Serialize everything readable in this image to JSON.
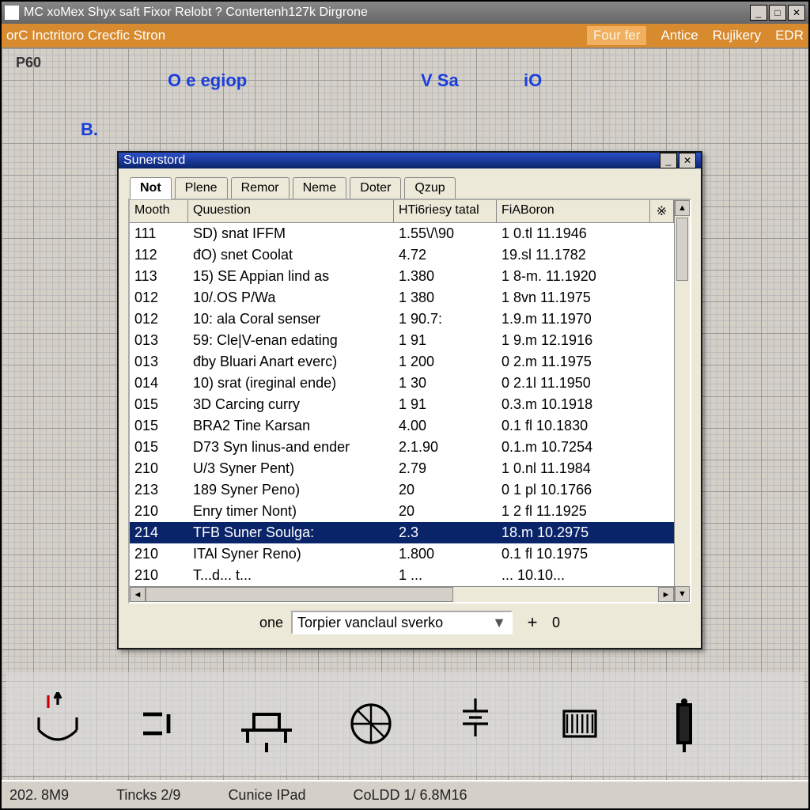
{
  "main_window": {
    "title": "MC xoMex Shyx saft Fixor Relobt ? Contertenh127k Dirgrone"
  },
  "menubar": {
    "left_label": "orC Inctritoro Crecfic Stron",
    "items": [
      "Four fer",
      "Antice",
      "Rujikery",
      "EDR"
    ]
  },
  "schematic_labels": {
    "p60": "P60",
    "oegiop": "O e  egiop",
    "vsa": "V Sa",
    "io": "iO",
    "b": "B."
  },
  "dialog": {
    "title": "Sunerstord",
    "tabs": [
      "Not",
      "Plene",
      "Remor",
      "Neme",
      "Doter",
      "Qzup"
    ],
    "active_tab_index": 0,
    "columns": [
      "Mooth",
      "Quuestion",
      "HTi6riesy tatal",
      "FiABoron"
    ],
    "header_end_glyph": "※",
    "rows": [
      {
        "c0": "111",
        "c1": "SD) snat IFFM",
        "c2": "1.55\\/\\90",
        "c3": "1 0.tl  11.1946"
      },
      {
        "c0": "112",
        "c1": "đO) snet Coolat",
        "c2": "4.72",
        "c3": "19.sl  11.1782"
      },
      {
        "c0": "113",
        "c1": "15) SE Appian lind as",
        "c2": "1.380",
        "c3": "1 8-m. 11.1920"
      },
      {
        "c0": "012",
        "c1": "10/.OS P/Wa",
        "c2": "1 380",
        "c3": "1 8vn  11.1975"
      },
      {
        "c0": "012",
        "c1": "10: ala Coral senser",
        "c2": "1 90.7:",
        "c3": "1.9.m  11.1970"
      },
      {
        "c0": "013",
        "c1": "59: Cle|V-enan edating",
        "c2": "1 91",
        "c3": "1 9.m  12.1916"
      },
      {
        "c0": "013",
        "c1": "đby Bluari Anart everc)",
        "c2": "1 200",
        "c3": "0 2.m  11.1975"
      },
      {
        "c0": "014",
        "c1": "10) srat (ireginal ende)",
        "c2": "1 30",
        "c3": "0 2.1l  11.1950"
      },
      {
        "c0": "015",
        "c1": "3D Carcing curry",
        "c2": "1 91",
        "c3": "0.3.m  10.1918"
      },
      {
        "c0": "015",
        "c1": "BRA2 Tine Karsan",
        "c2": "4.00",
        "c3": "0.1 fl  10.1830"
      },
      {
        "c0": "015",
        "c1": "D73 Syn linus-and ender",
        "c2": "2.1.90",
        "c3": "0.1.m  10.7254"
      },
      {
        "c0": "210",
        "c1": "U/3 Syner Pent)",
        "c2": "2.79",
        "c3": "1 0.nl  11.1984"
      },
      {
        "c0": "213",
        "c1": "189 Syner Peno)",
        "c2": "20",
        "c3": "0 1 pl  10.1766"
      },
      {
        "c0": "210",
        "c1": "Enry timer Nont)",
        "c2": "20",
        "c3": "1 2 fl  11.1925"
      },
      {
        "c0": "214",
        "c1": "TFB Suner Soulga:",
        "c2": "2.3",
        "c3": "18.m  10.2975"
      },
      {
        "c0": "210",
        "c1": "ITAl Syner Reno)",
        "c2": "1.800",
        "c3": "0.1 fl  10.1975"
      },
      {
        "c0": "210",
        "c1": "T...d... t...",
        "c2": "1 ...",
        "c3": "...  10.10..."
      }
    ],
    "selected_row_index": 14,
    "footer": {
      "label": "one",
      "dropdown_value": "Torpier vanclaul sverko",
      "plus_label": "+",
      "count": "0"
    }
  },
  "statusbar": {
    "s1": "202. 8M9",
    "s2": "Tincks 2/9",
    "s3": "Cunice IPad",
    "s4": "CoLDD 1/ 6.8M16"
  }
}
